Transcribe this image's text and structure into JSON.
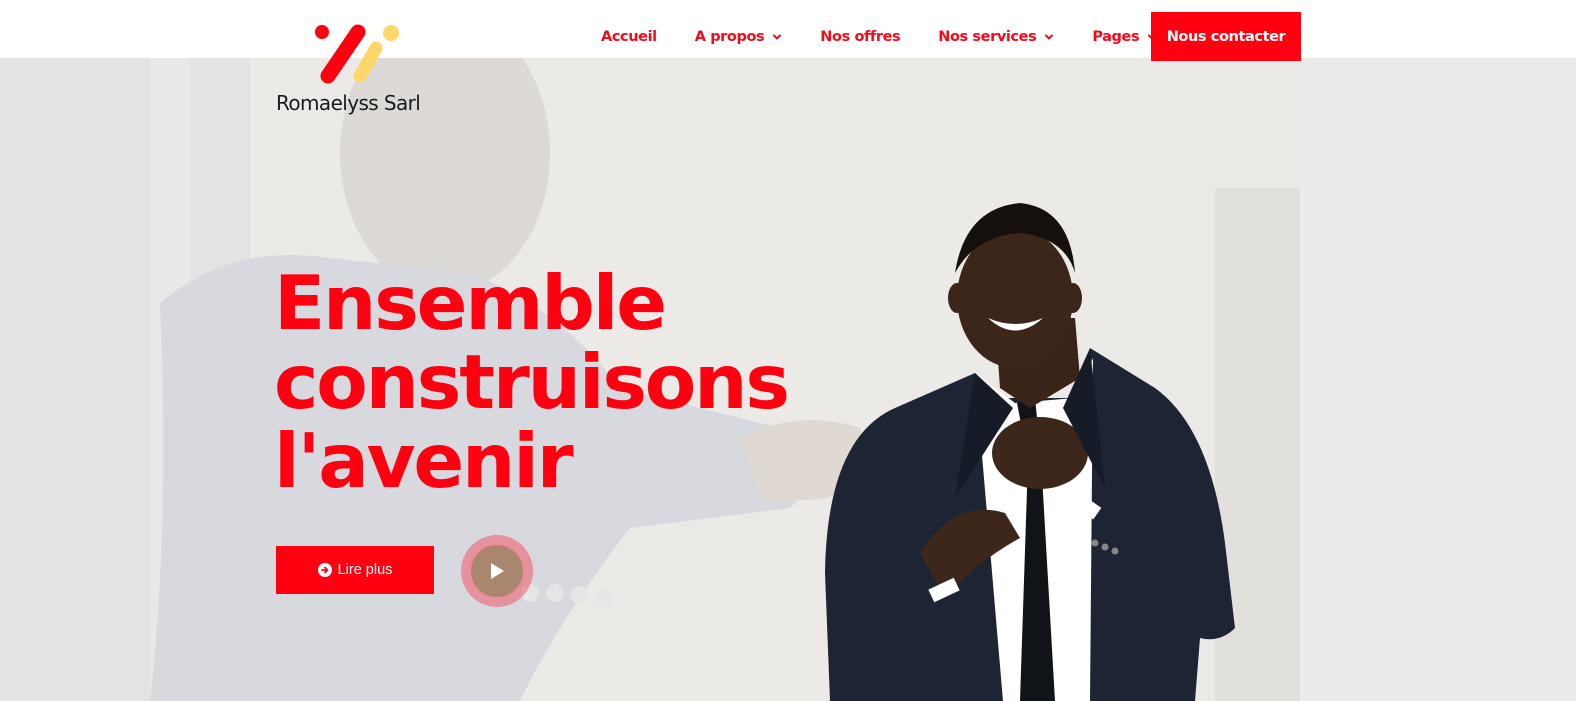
{
  "brand": {
    "name": "Romaelyss Sarl",
    "colors": {
      "primary": "#fe0010",
      "accent_yellow": "#fcd86a",
      "dark": "#1a1a1a"
    },
    "logo_icon": "brand-strokes-icon"
  },
  "nav": {
    "items": [
      {
        "label": "Accueil",
        "has_dropdown": false
      },
      {
        "label": "A propos",
        "has_dropdown": true
      },
      {
        "label": "Nos offres",
        "has_dropdown": false
      },
      {
        "label": "Nos services",
        "has_dropdown": true
      },
      {
        "label": "Pages",
        "has_dropdown": true
      }
    ],
    "cta_label": "Nous contacter",
    "dropdown_icon": "chevron-down-icon"
  },
  "hero": {
    "title_lines": [
      "Ensemble",
      "construisons",
      "l'avenir"
    ],
    "read_more_label": "Lire plus",
    "read_more_icon": "arrow-circle-right-icon",
    "play_icon": "play-icon",
    "background_image": "handshake-photo",
    "foreground_image": "businessman-photo"
  }
}
